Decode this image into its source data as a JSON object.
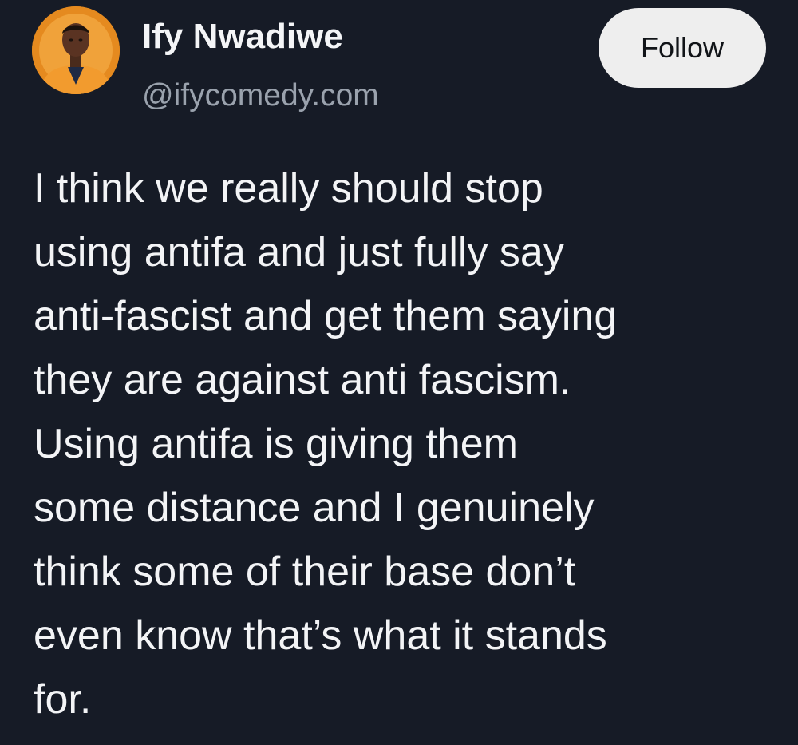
{
  "post": {
    "author": {
      "display_name": "Ify Nwadiwe",
      "handle": "@ifycomedy.com",
      "avatar_icon": "profile-photo",
      "avatar_accent": "#e58a1f"
    },
    "follow_label": "Follow",
    "text_lines": [
      "I think we really should stop",
      "using antifa and just fully say",
      "anti-fascist and get them saying",
      "they are against anti fascism.",
      "Using antifa is giving them",
      "some distance and I genuinely",
      "think some of their base don’t",
      "even know that’s what it stands",
      "for."
    ]
  },
  "colors": {
    "background": "#161b26",
    "text": "#f3f4f6",
    "secondary_text": "#9aa2ad",
    "button_bg": "#eeeeee",
    "button_text": "#111418"
  }
}
